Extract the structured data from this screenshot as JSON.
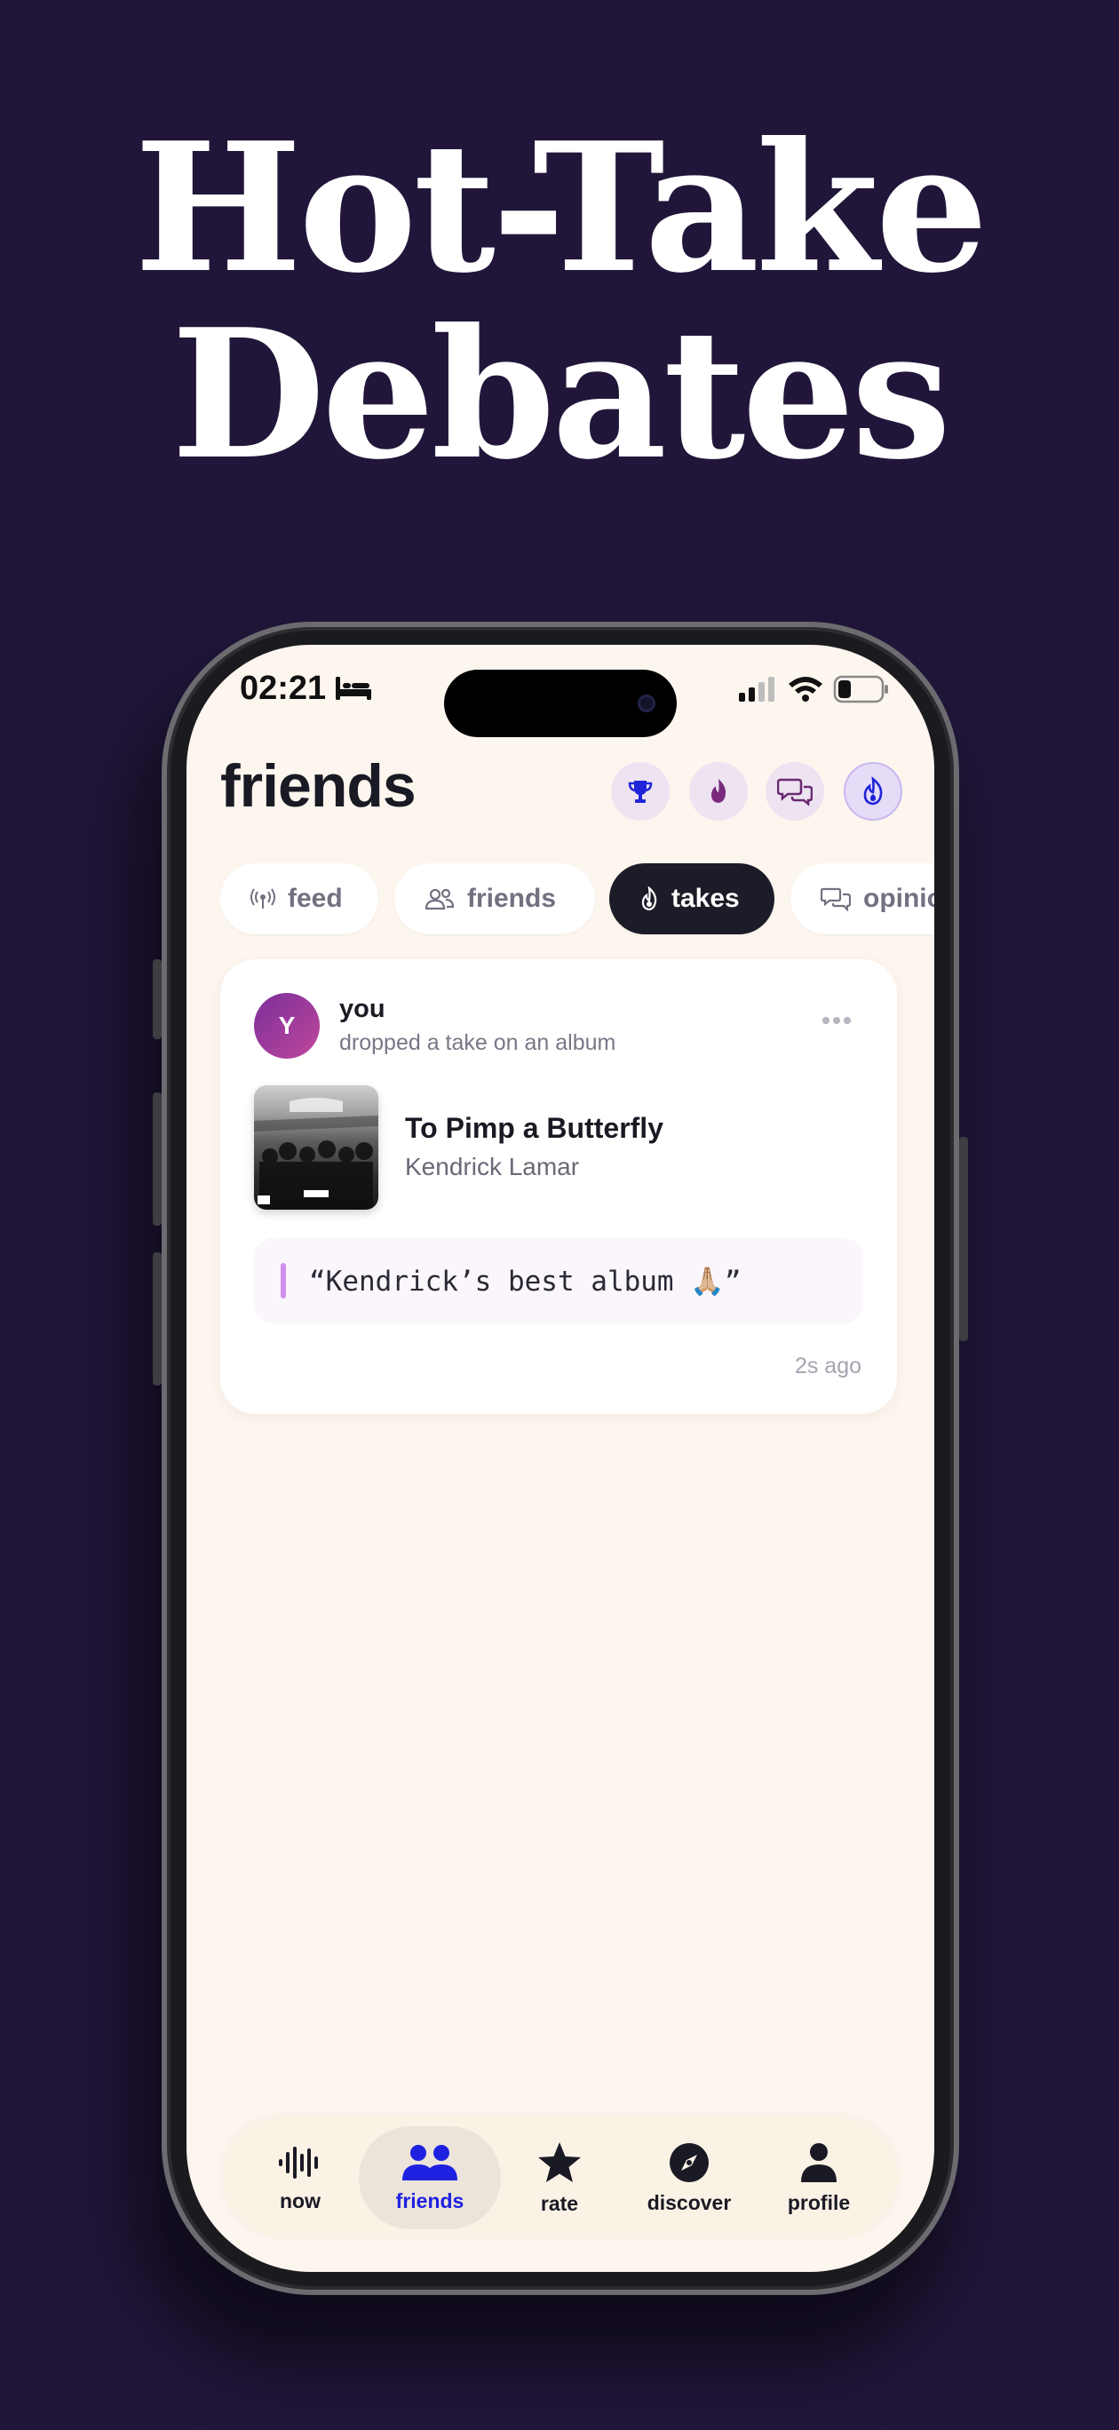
{
  "headline": {
    "line1": "Hot-Take",
    "line2": "Debates"
  },
  "status_bar": {
    "time": "02:21"
  },
  "header": {
    "title": "friends"
  },
  "header_buttons": [
    {
      "icon": "trophy-icon"
    },
    {
      "icon": "flame-icon"
    },
    {
      "icon": "chat-bubbles-icon"
    },
    {
      "icon": "flame-outline-icon"
    }
  ],
  "tabs": [
    {
      "label": "feed",
      "icon": "broadcast-icon",
      "active": false
    },
    {
      "label": "friends",
      "icon": "people-icon",
      "active": false
    },
    {
      "label": "takes",
      "icon": "flame-icon",
      "active": true
    },
    {
      "label": "opinions",
      "icon": "chat-bubbles-icon",
      "active": false
    }
  ],
  "post": {
    "avatar_initial": "Y",
    "username": "you",
    "action": "dropped a take on an album",
    "album_title": "To Pimp a Butterfly",
    "album_artist": "Kendrick Lamar",
    "quote": "“Kendrick’s best album 🙏🏼”",
    "timestamp": "2s ago"
  },
  "nav": [
    {
      "label": "now",
      "icon": "waveform-icon",
      "active": false
    },
    {
      "label": "friends",
      "icon": "people-icon",
      "active": true
    },
    {
      "label": "rate",
      "icon": "star-icon",
      "active": false
    },
    {
      "label": "discover",
      "icon": "compass-icon",
      "active": false
    },
    {
      "label": "profile",
      "icon": "person-icon",
      "active": false
    }
  ],
  "colors": {
    "background": "#21163a",
    "screen": "#fdf6ef",
    "accent": "#1e22e0",
    "active_tab": "#1c1c28",
    "quote_bar": "#d18ff0"
  }
}
